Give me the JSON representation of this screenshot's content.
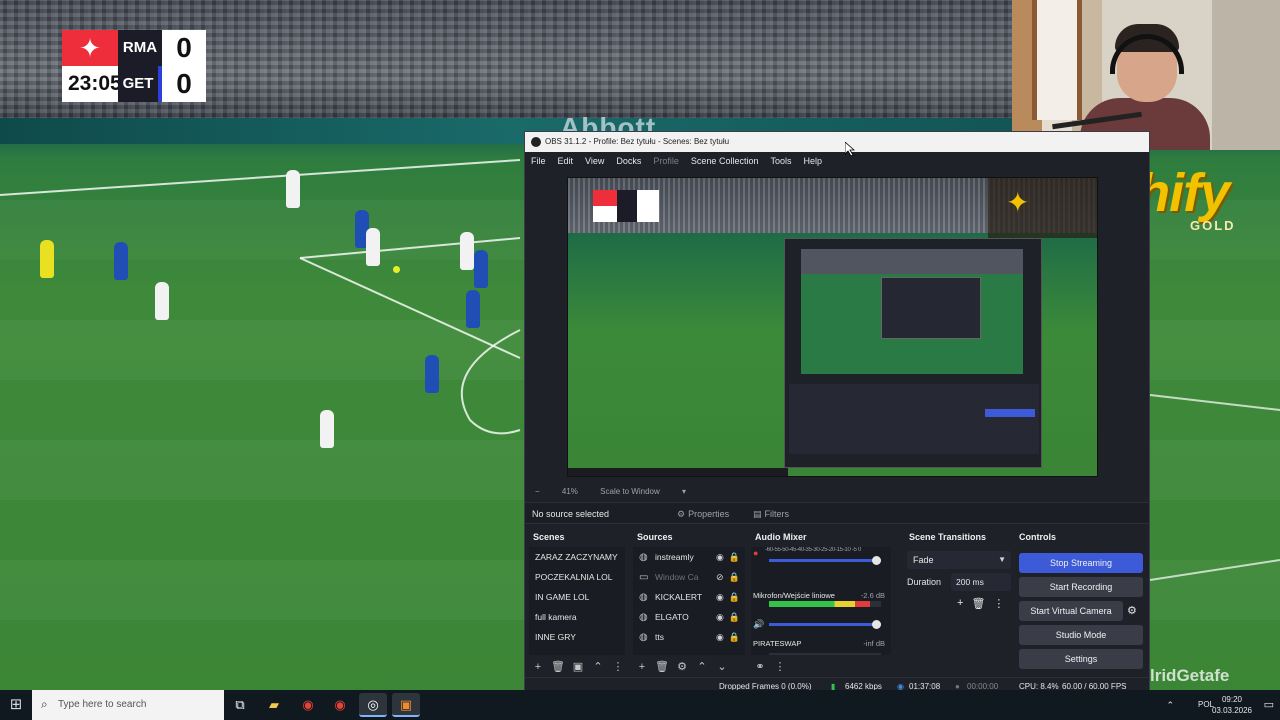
{
  "scoreboard": {
    "league_logo": "LaLiga logo",
    "home_team": "RMA",
    "away_team": "GET",
    "home_score": "0",
    "away_score": "0",
    "match_clock": "23:05"
  },
  "stadium": {
    "ad_board_text": "Abbott"
  },
  "branding": {
    "logo_text": "cashify",
    "logo_sub": "GOLD",
    "watermark": "lridGetafe"
  },
  "obs": {
    "title": "OBS 31.1.2 - Profile: Bez tytułu - Scenes: Bez tytułu",
    "menu": [
      "File",
      "Edit",
      "View",
      "Docks",
      "Profile",
      "Scene Collection",
      "Tools",
      "Help"
    ],
    "zoom": {
      "percent": "41%",
      "mode": "Scale to Window"
    },
    "source_bar": {
      "no_source": "No source selected",
      "properties": "Properties",
      "filters": "Filters"
    },
    "scenes": {
      "title": "Scenes",
      "items": [
        "ZARAZ ZACZYNAMY",
        "POCZEKALNIA LOL",
        "IN GAME LOL",
        "full kamera",
        "INNE GRY"
      ]
    },
    "sources": {
      "title": "Sources",
      "items": [
        {
          "name": "instreamly",
          "visible": true
        },
        {
          "name": "Window Ca",
          "visible": false
        },
        {
          "name": "KICKALERT",
          "visible": true
        },
        {
          "name": "ELGATO",
          "visible": true
        },
        {
          "name": "tts",
          "visible": true
        }
      ]
    },
    "audio_mixer": {
      "title": "Audio Mixer",
      "scale": "-60-55-50-45-40-35-30-25-20-15-10 -5 0",
      "channels": [
        {
          "name": "",
          "db": "",
          "level": 0.0
        },
        {
          "name": "Mikrofon/Wejście liniowe",
          "db": "-2.6 dB",
          "level": 0.9
        },
        {
          "name": "PIRATESWAP",
          "db": "-inf dB",
          "level": 0.0
        }
      ]
    },
    "scene_transitions": {
      "title": "Scene Transitions",
      "transition": "Fade",
      "duration_label": "Duration",
      "duration_value": "200 ms"
    },
    "controls": {
      "title": "Controls",
      "stop_streaming": "Stop Streaming",
      "start_recording": "Start Recording",
      "start_virtual_camera": "Start Virtual Camera",
      "studio_mode": "Studio Mode",
      "settings": "Settings"
    },
    "status": {
      "dropped_frames": "Dropped Frames 0 (0.0%)",
      "bitrate": "6462 kbps",
      "stream_time": "01:37:08",
      "record_time": "00:00:00",
      "cpu": "CPU: 8.4%",
      "fps": "60.00 / 60.00 FPS"
    }
  },
  "taskbar": {
    "search_placeholder": "Type here to search",
    "apps": [
      "Task View",
      "File Explorer",
      "Chrome",
      "Chrome",
      "OBS Studio",
      "Extra App"
    ],
    "language": "POL",
    "time": "09:20",
    "date": "03.03.2026"
  },
  "colors": {
    "accent": "#3d5ad9",
    "laliga_red": "#ef2e3b",
    "cashify_gold": "#f2c200"
  }
}
